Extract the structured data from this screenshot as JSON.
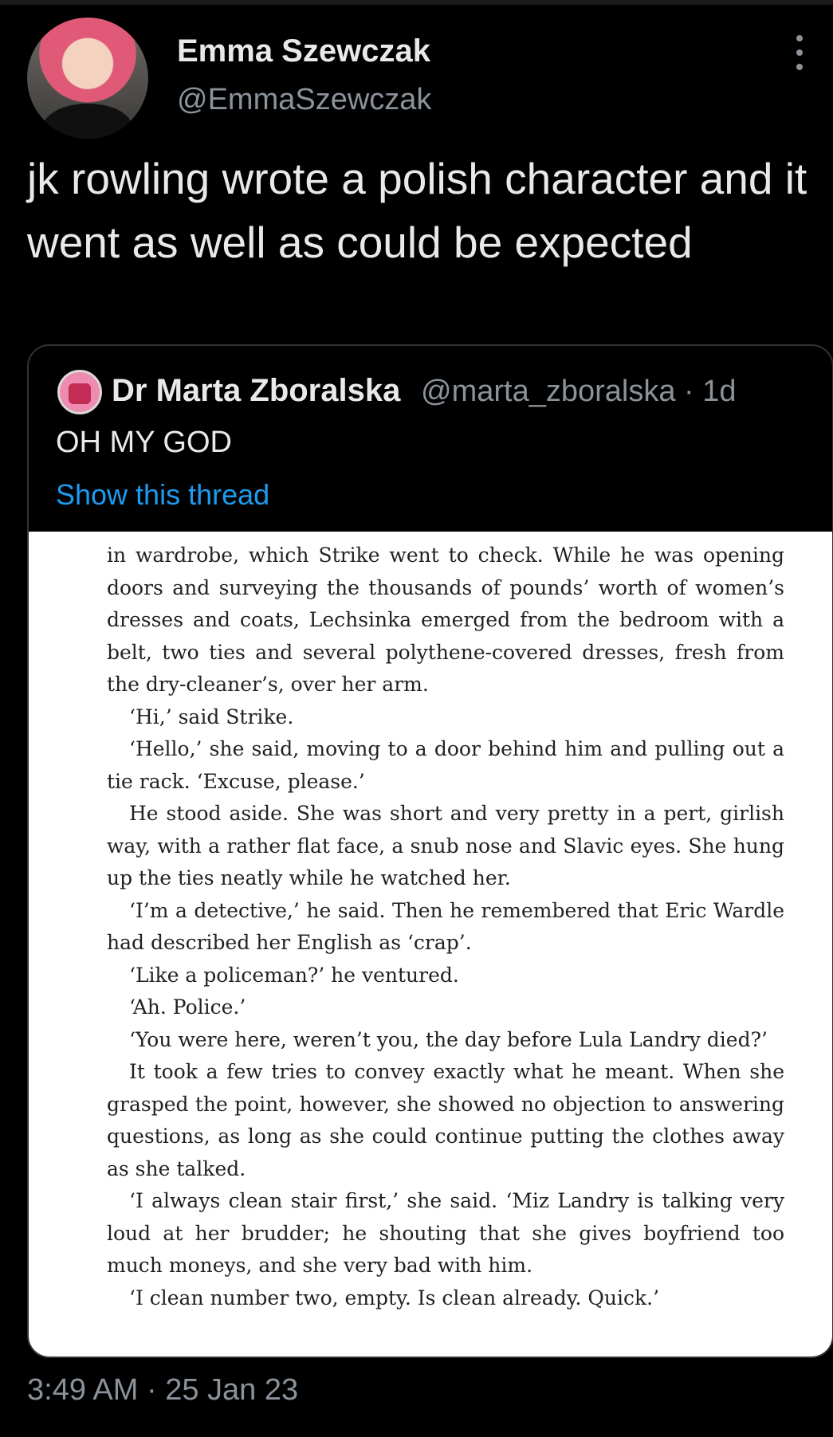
{
  "author": {
    "name": "Emma Szewczak",
    "handle": "@EmmaSzewczak"
  },
  "tweet": {
    "text": "jk rowling wrote a polish character and it went as well as could be expected",
    "timestamp": "3:49 AM · 25 Jan 23"
  },
  "quoted_tweet": {
    "name": "Dr Marta Zboralska",
    "handle_time": "@marta_zboralska · 1d",
    "text": "OH MY GOD",
    "thread_link": "Show this thread",
    "book_paragraphs": [
      {
        "text": "in wardrobe, which Strike went to check. While he was opening doors and surveying the thousands of pounds’ worth of women’s dresses and coats, Lechsinka emerged from the bedroom with a belt, two ties and several polythene-covered dresses, fresh from the dry-cleaner’s, over her arm.",
        "indent": false
      },
      {
        "text": "‘Hi,’ said Strike.",
        "indent": true
      },
      {
        "text": "‘Hello,’ she said, moving to a door behind him and pulling out a tie rack. ‘Excuse, please.’",
        "indent": true
      },
      {
        "text": "He stood aside. She was short and very pretty in a pert, girlish way, with a rather flat face, a snub nose and Slavic eyes. She hung up the ties neatly while he watched her.",
        "indent": true
      },
      {
        "text": "‘I’m a detective,’ he said. Then he remembered that Eric Wardle had described her English as ‘crap’.",
        "indent": true
      },
      {
        "text": "‘Like a policeman?’ he ventured.",
        "indent": true
      },
      {
        "text": "‘Ah. Police.’",
        "indent": true
      },
      {
        "text": "‘You were here, weren’t you, the day before Lula Landry died?’",
        "indent": true
      },
      {
        "text": "It took a few tries to convey exactly what he meant. When she grasped the point, however, she showed no objection to answering questions, as long as she could continue putting the clothes away as she talked.",
        "indent": true
      },
      {
        "text": "‘I always clean stair first,’ she said. ‘Miz Landry is talking very loud at her brudder; he shouting that she gives boyfriend too much moneys, and she very bad with him.",
        "indent": true
      },
      {
        "text": "‘I clean number two, empty. Is clean already. Quick.’",
        "indent": true
      }
    ]
  }
}
